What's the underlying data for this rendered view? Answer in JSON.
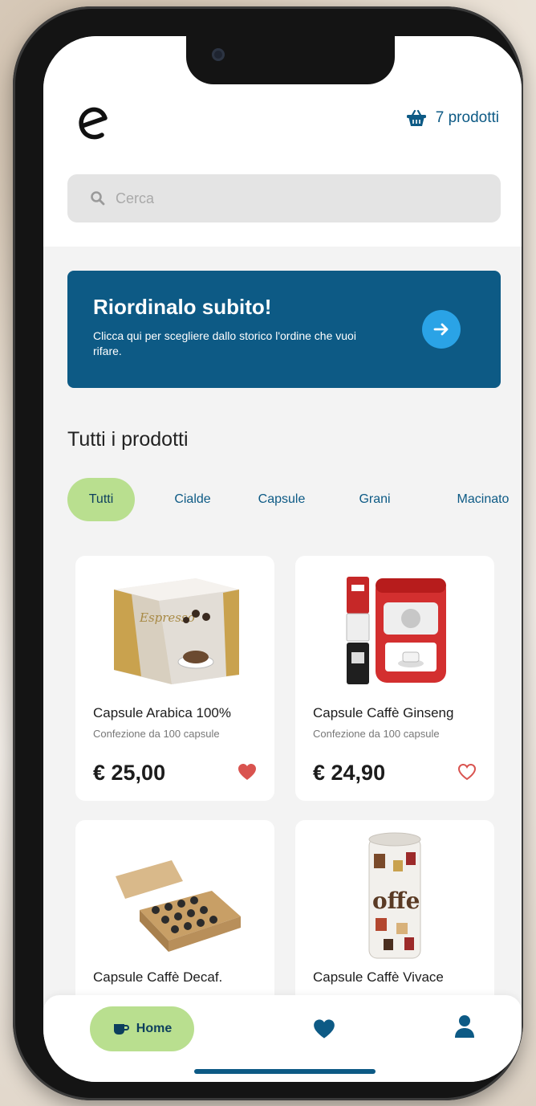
{
  "header": {
    "cart_label": "7 prodotti"
  },
  "search": {
    "placeholder": "Cerca"
  },
  "promo": {
    "title": "Riordinalo subito!",
    "text": "Clicca qui per scegliere dallo storico l'ordine che vuoi rifare."
  },
  "section": {
    "title": "Tutti i prodotti"
  },
  "categories": [
    {
      "label": "Tutti",
      "active": true
    },
    {
      "label": "Cialde",
      "active": false
    },
    {
      "label": "Capsule",
      "active": false
    },
    {
      "label": "Grani",
      "active": false
    },
    {
      "label": "Macinato",
      "active": false
    }
  ],
  "products": [
    {
      "name": "Capsule Arabica 100%",
      "desc": "Confezione da 100 capsule",
      "price": "€ 25,00",
      "favorite": true,
      "image": "espresso-box"
    },
    {
      "name": "Capsule Caffè Ginseng",
      "desc": "Confezione da 100 capsule",
      "price": "€ 24,90",
      "favorite": false,
      "image": "red-tin"
    },
    {
      "name": "Capsule Caffè Decaf.",
      "desc": "",
      "price": "",
      "favorite": false,
      "image": "open-box"
    },
    {
      "name": "Capsule Caffè Vivace",
      "desc": "",
      "price": "",
      "favorite": false,
      "image": "coffee-can"
    }
  ],
  "nav": {
    "home_label": "Home"
  },
  "colors": {
    "brand": "#0d5a85",
    "accent_green": "#b9df8f",
    "heart_red": "#d9534f",
    "arrow_blue": "#2aa3e6"
  }
}
